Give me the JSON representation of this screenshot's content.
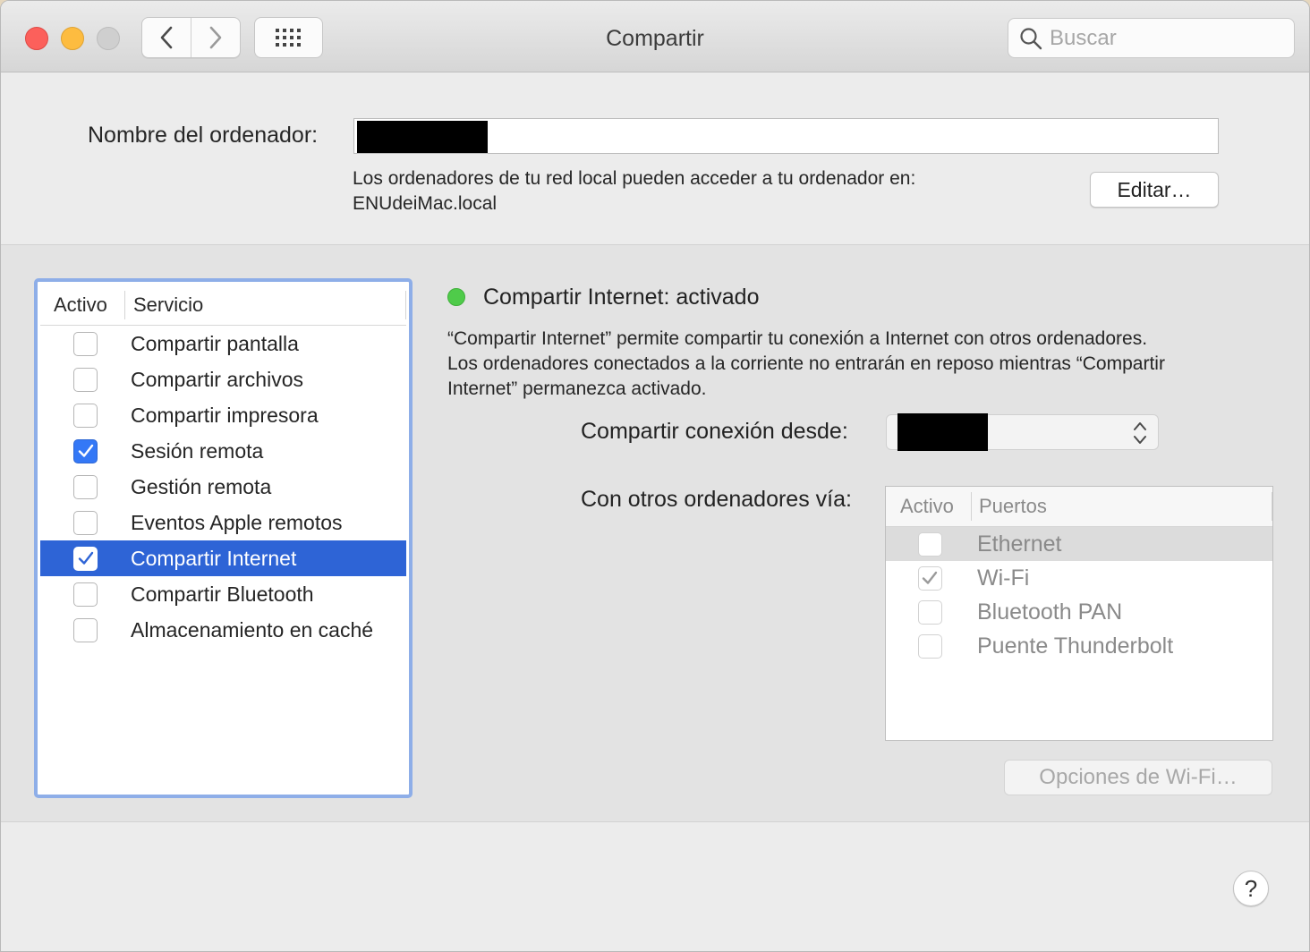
{
  "window": {
    "title": "Compartir",
    "search_placeholder": "Buscar"
  },
  "computer_name": {
    "label": "Nombre del ordenador:",
    "local_access_text": "Los ordenadores de tu red local pueden acceder a tu ordenador en:",
    "local_address": "ENUdeiMac.local",
    "edit_label": "Editar…"
  },
  "services": {
    "header_active": "Activo",
    "header_service": "Servicio",
    "items": [
      {
        "label": "Compartir pantalla",
        "checked": false,
        "selected": false
      },
      {
        "label": "Compartir archivos",
        "checked": false,
        "selected": false
      },
      {
        "label": "Compartir impresora",
        "checked": false,
        "selected": false
      },
      {
        "label": "Sesión remota",
        "checked": true,
        "selected": false
      },
      {
        "label": "Gestión remota",
        "checked": false,
        "selected": false
      },
      {
        "label": "Eventos Apple remotos",
        "checked": false,
        "selected": false
      },
      {
        "label": "Compartir Internet",
        "checked": true,
        "selected": true
      },
      {
        "label": "Compartir Bluetooth",
        "checked": false,
        "selected": false
      },
      {
        "label": "Almacenamiento en caché",
        "checked": false,
        "selected": false
      }
    ]
  },
  "detail": {
    "status_title": "Compartir Internet: activado",
    "status_color": "#4fcb4a",
    "description_line1": "“Compartir Internet” permite compartir tu conexión a Internet con otros ordenadores.",
    "description_line2": "Los ordenadores conectados a la corriente no entrarán en reposo mientras “Compartir",
    "description_line3": "Internet” permanezca activado.",
    "share_from_label": "Compartir conexión desde:",
    "via_label": "Con otros ordenadores vía:",
    "ports_header_active": "Activo",
    "ports_header_ports": "Puertos",
    "ports": [
      {
        "label": "Ethernet",
        "checked": false,
        "highlight": true
      },
      {
        "label": "Wi-Fi",
        "checked": true,
        "highlight": false
      },
      {
        "label": "Bluetooth PAN",
        "checked": false,
        "highlight": false
      },
      {
        "label": "Puente Thunderbolt",
        "checked": false,
        "highlight": false
      }
    ],
    "wifi_options_label": "Opciones de Wi-Fi…"
  },
  "help_label": "?",
  "colors": {
    "accent": "#2e64d6",
    "focus_ring": "#8eaee8",
    "close": "#fc605b",
    "minimize": "#fdbc40"
  }
}
